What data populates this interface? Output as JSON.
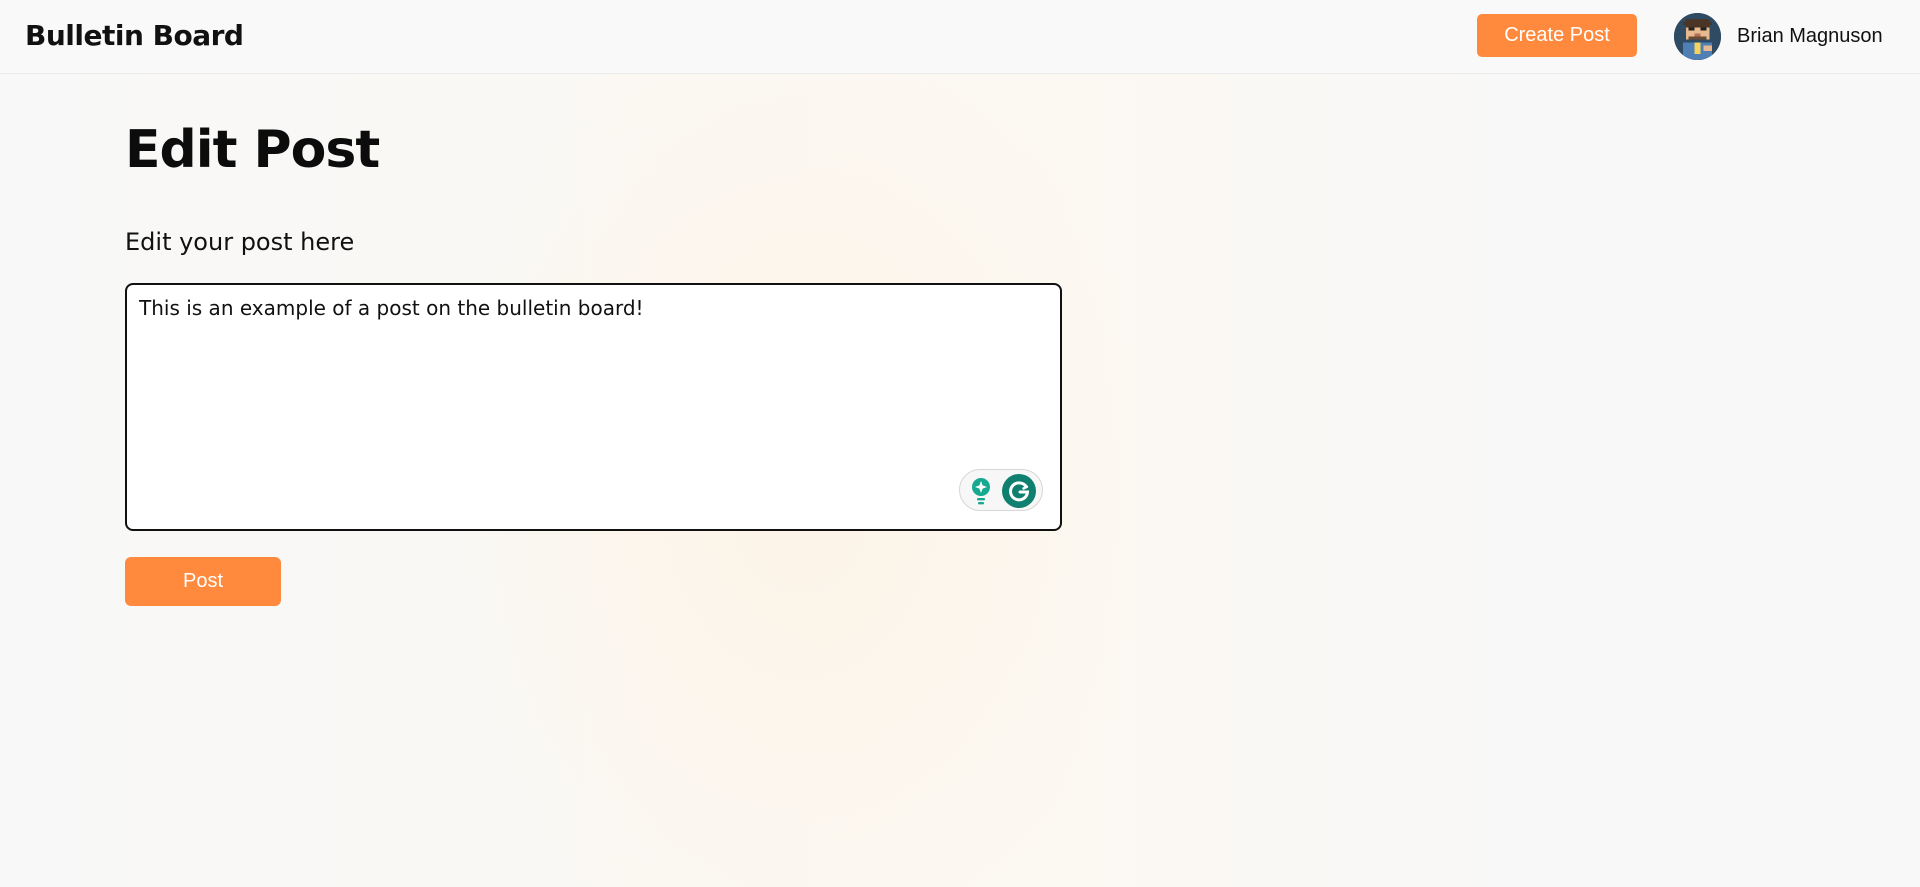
{
  "header": {
    "brand": "Bulletin Board",
    "create_post_label": "Create Post",
    "user_name": "Brian Magnuson",
    "avatar_icon": "pixel-art-avatar-icon"
  },
  "main": {
    "title": "Edit Post",
    "field_label": "Edit your post here",
    "post_content": "This is an example of a post on the bulletin board!",
    "post_button_label": "Post",
    "writing_assistant": {
      "icons": [
        "lightbulb-sparkle-icon",
        "grammarly-g-icon"
      ]
    }
  },
  "colors": {
    "accent": "#ff8a3d",
    "assistant_teal": "#15a98f",
    "grammarly_green": "#0f7f6f"
  }
}
